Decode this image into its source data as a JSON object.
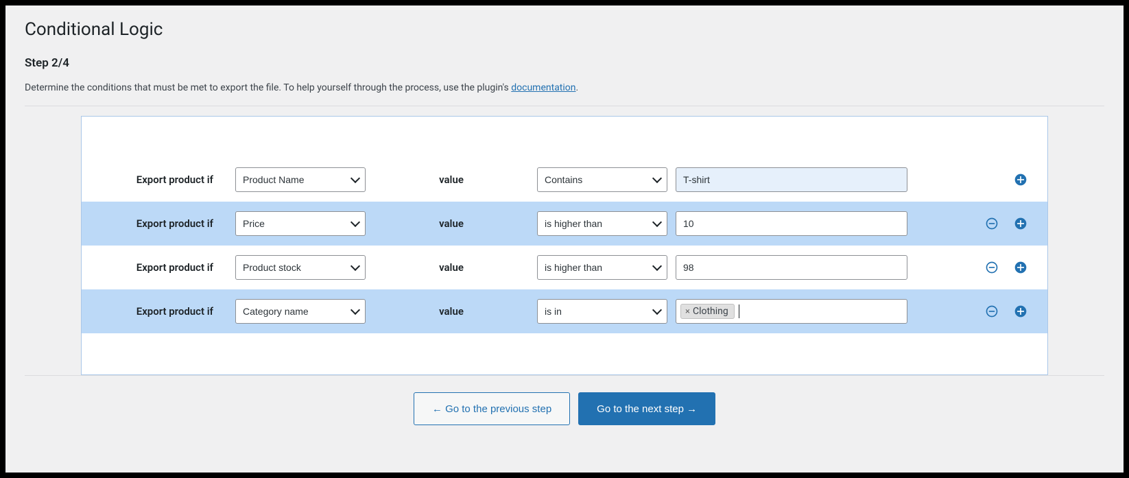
{
  "header": {
    "title": "Conditional Logic",
    "step": "Step 2/4",
    "description_prefix": "Determine the conditions that must be met to export the file. To help yourself through the process, use the plugin's ",
    "doc_link": "documentation",
    "description_suffix": "."
  },
  "labels": {
    "condition_prefix": "Export product if",
    "value": "value"
  },
  "rows": [
    {
      "field": "Product Name",
      "operator": "Contains",
      "value_type": "text",
      "value": "T-shirt",
      "active": true,
      "show_remove": false
    },
    {
      "field": "Price",
      "operator": "is higher than",
      "value_type": "text",
      "value": "10",
      "active": false,
      "show_remove": true,
      "highlight": true
    },
    {
      "field": "Product stock",
      "operator": "is higher than",
      "value_type": "text",
      "value": "98",
      "active": false,
      "show_remove": true
    },
    {
      "field": "Category name",
      "operator": "is in",
      "value_type": "tags",
      "tags": [
        "Clothing"
      ],
      "show_remove": true,
      "highlight": true
    }
  ],
  "footer": {
    "prev": "← Go to the previous step",
    "next": "Go to the next step →"
  }
}
